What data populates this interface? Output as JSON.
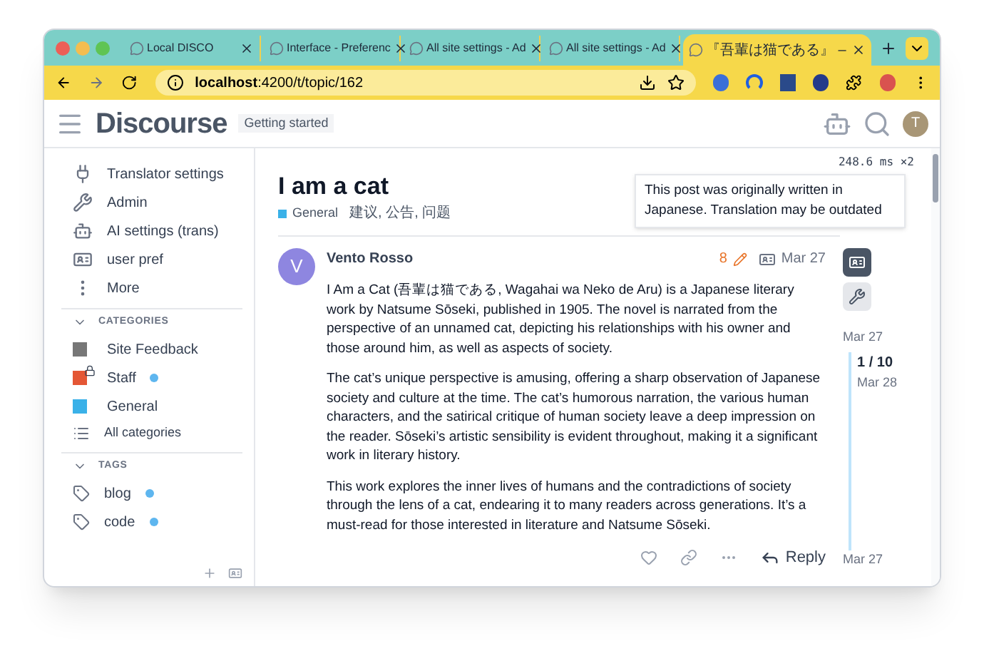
{
  "browser": {
    "tabs": [
      {
        "title": "Local DISCO",
        "selected": false
      },
      {
        "title": "Interface - Preferenc",
        "selected": false
      },
      {
        "title": "All site settings - Ad",
        "selected": false
      },
      {
        "title": "All site settings - Ad",
        "selected": false
      },
      {
        "title": "『吾輩は猫である』 –",
        "selected": true
      }
    ],
    "url_host": "localhost",
    "url_path": ":4200/t/topic/162"
  },
  "header": {
    "logo": "Discourse",
    "badge": "Getting started",
    "avatar": "T",
    "timing": "248.6",
    "timing_unit": "ms",
    "timing_count": "×2"
  },
  "sidebar": {
    "items": [
      {
        "label": "Translator settings",
        "kind": "plug"
      },
      {
        "label": "Admin",
        "kind": "wrench"
      },
      {
        "label": "AI settings (trans)",
        "kind": "robot"
      },
      {
        "label": "user pref",
        "kind": "card"
      },
      {
        "label": "More",
        "kind": "dots"
      }
    ],
    "categories_heading": "CATEGORIES",
    "expanded": true,
    "categories": [
      {
        "label": "Site Feedback",
        "color": "#777777",
        "locked": false,
        "unread": false
      },
      {
        "label": "Staff",
        "color": "#e45735",
        "locked": true,
        "unread": true
      },
      {
        "label": "General",
        "color": "#3ab1e8",
        "locked": false,
        "unread": false
      }
    ],
    "all_categories": "All categories",
    "tags_heading": "TAGS",
    "tags": [
      {
        "label": "blog",
        "unread": true
      },
      {
        "label": "code",
        "unread": true
      }
    ]
  },
  "topic": {
    "title": "I am a cat",
    "category": {
      "label": "General",
      "color": "#3ab1e8"
    },
    "tags": "建议, 公告, 问题"
  },
  "tooltip": "This post was originally written in Japanese. Translation may be outdated",
  "post": {
    "avatar": "V",
    "author": "Vento Rosso",
    "edits": "8",
    "date": "Mar 27",
    "paragraphs": [
      "I Am a Cat (吾輩は猫である, Wagahai wa Neko de Aru) is a Japanese literary work by Natsume Sōseki, published in 1905. The novel is narrated from the perspective of an unnamed cat, depicting his relationships with his owner and those around him, as well as aspects of society.",
      "The cat’s unique perspective is amusing, offering a sharp observation of Japanese society and culture at the time. The cat’s humorous narration, the various human characters, and the satirical critique of human society leave a deep impression on the reader. Sōseki’s artistic sensibility is evident throughout, making it a significant work in literary history.",
      "This work explores the inner lives of humans and the contradictions of society through the lens of a cat, endearing it to many readers across generations. It’s a must-read for those interested in literature and Natsume Sōseki."
    ],
    "reply": "Reply"
  },
  "timeline": {
    "start": "Mar 27",
    "position": "1 / 10",
    "position_date": "Mar 28",
    "end": "Mar 27"
  }
}
